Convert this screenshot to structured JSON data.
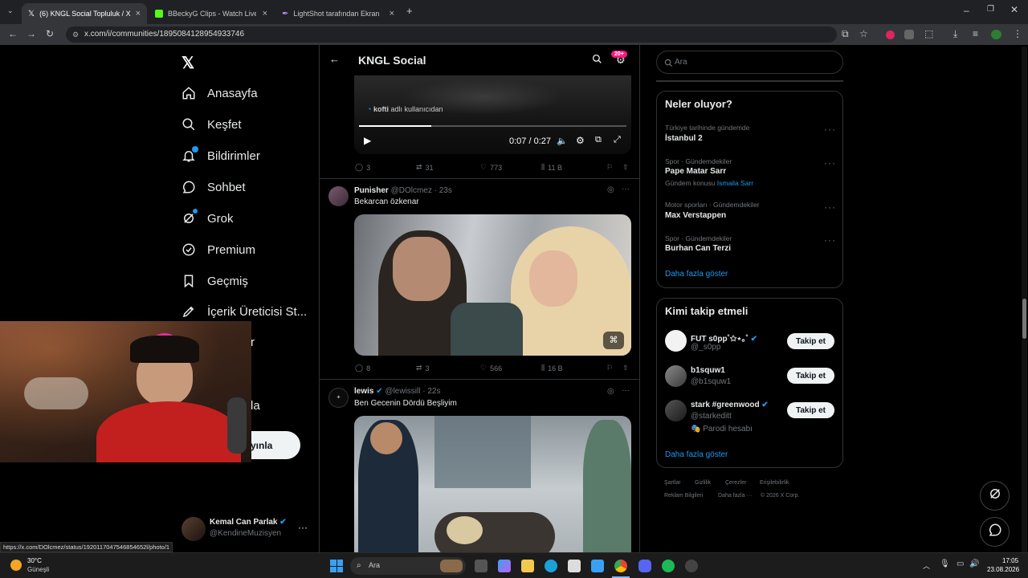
{
  "browser": {
    "tabs": [
      {
        "title": "(6) KNGL Social Topluluk / X"
      },
      {
        "title": "BBeckyG Clips - Watch Live on K"
      },
      {
        "title": "LightShot tarafından Ekran Görün"
      }
    ],
    "url": "x.com/i/communities/1895084128954933746",
    "status_url": "https://x.com/DOlcmez/status/1920117047546854652l/photo/1"
  },
  "nav": {
    "items": [
      {
        "label": "Anasayfa",
        "icon": "home-icon"
      },
      {
        "label": "Keşfet",
        "icon": "search-icon"
      },
      {
        "label": "Bildirimler",
        "icon": "bell-icon"
      },
      {
        "label": "Sohbet",
        "icon": "chat-icon"
      },
      {
        "label": "Grok",
        "icon": "grok-icon"
      },
      {
        "label": "Premium",
        "icon": "premium-icon"
      },
      {
        "label": "Geçmiş",
        "icon": "bookmark-icon"
      },
      {
        "label": "İçerik Üreticisi St...",
        "icon": "rocket-icon"
      }
    ],
    "partial_r": "r",
    "partial_la": "la",
    "post_button": "yınla",
    "profile": {
      "name": "Kemal Can Parlak",
      "handle": "@KendineMuzisyen"
    }
  },
  "header": {
    "title": "KNGL Social",
    "badge": "20+"
  },
  "video": {
    "credit_user": "kofti",
    "credit_text": "adlı kullanıcıdan",
    "time": "0:07 / 0:27"
  },
  "post0_actions": {
    "replies": "3",
    "reposts": "31",
    "likes": "773",
    "views": "11 B"
  },
  "post1": {
    "name": "Punisher",
    "handle": "@DOlcmez · 23s",
    "text": "Bekarcan özkenar",
    "replies": "8",
    "reposts": "3",
    "likes": "566",
    "views": "16 B"
  },
  "post2": {
    "name": "lewis",
    "handle": "@lewissill · 22s",
    "text": "Ben Gecenin Dördü Beşliyim"
  },
  "search": {
    "placeholder": "Ara"
  },
  "trends": {
    "title": "Neler oluyor?",
    "items": [
      {
        "meta": "Türkiye tarihinde gündemde",
        "title": "İstanbul 2"
      },
      {
        "meta": "Spor · Gündemdekiler",
        "title": "Pape Matar Sarr",
        "extra_prefix": "Gündem konusu",
        "extra_link": "Ismaila Sarr"
      },
      {
        "meta": "Motor sporları · Gündemdekiler",
        "title": "Max Verstappen"
      },
      {
        "meta": "Spor · Gündemdekiler",
        "title": "Burhan Can Terzi"
      }
    ],
    "more": "Daha fazla göster"
  },
  "follow": {
    "title": "Kimi takip etmeli",
    "items": [
      {
        "name": "FUT s0pp˚✩⋆｡˚",
        "handle": "@_s0pp",
        "button": "Takip et"
      },
      {
        "name": "b1squw1",
        "handle": "@b1squw1",
        "button": "Takip et"
      },
      {
        "name": "stark #greenwood",
        "handle": "@starkeditt",
        "button": "Takip et",
        "note": "🎭 Parodi hesabı"
      }
    ],
    "more": "Daha fazla göster"
  },
  "footer": {
    "links1": [
      "Şartlar",
      "Gizlilik",
      "Çerezler",
      "Erişilebilirlik"
    ],
    "links2": [
      "Reklam Bilgileri",
      "Daha fazla ···",
      "© 2026 X Corp."
    ]
  },
  "taskbar": {
    "temp": "30°C",
    "weather": "Güneşli",
    "search": "Ara",
    "time": "17:05",
    "date": "23.08.2026"
  },
  "colors": {
    "accent": "#1d9bf0",
    "badge": "#f91880",
    "bg": "#000000"
  }
}
